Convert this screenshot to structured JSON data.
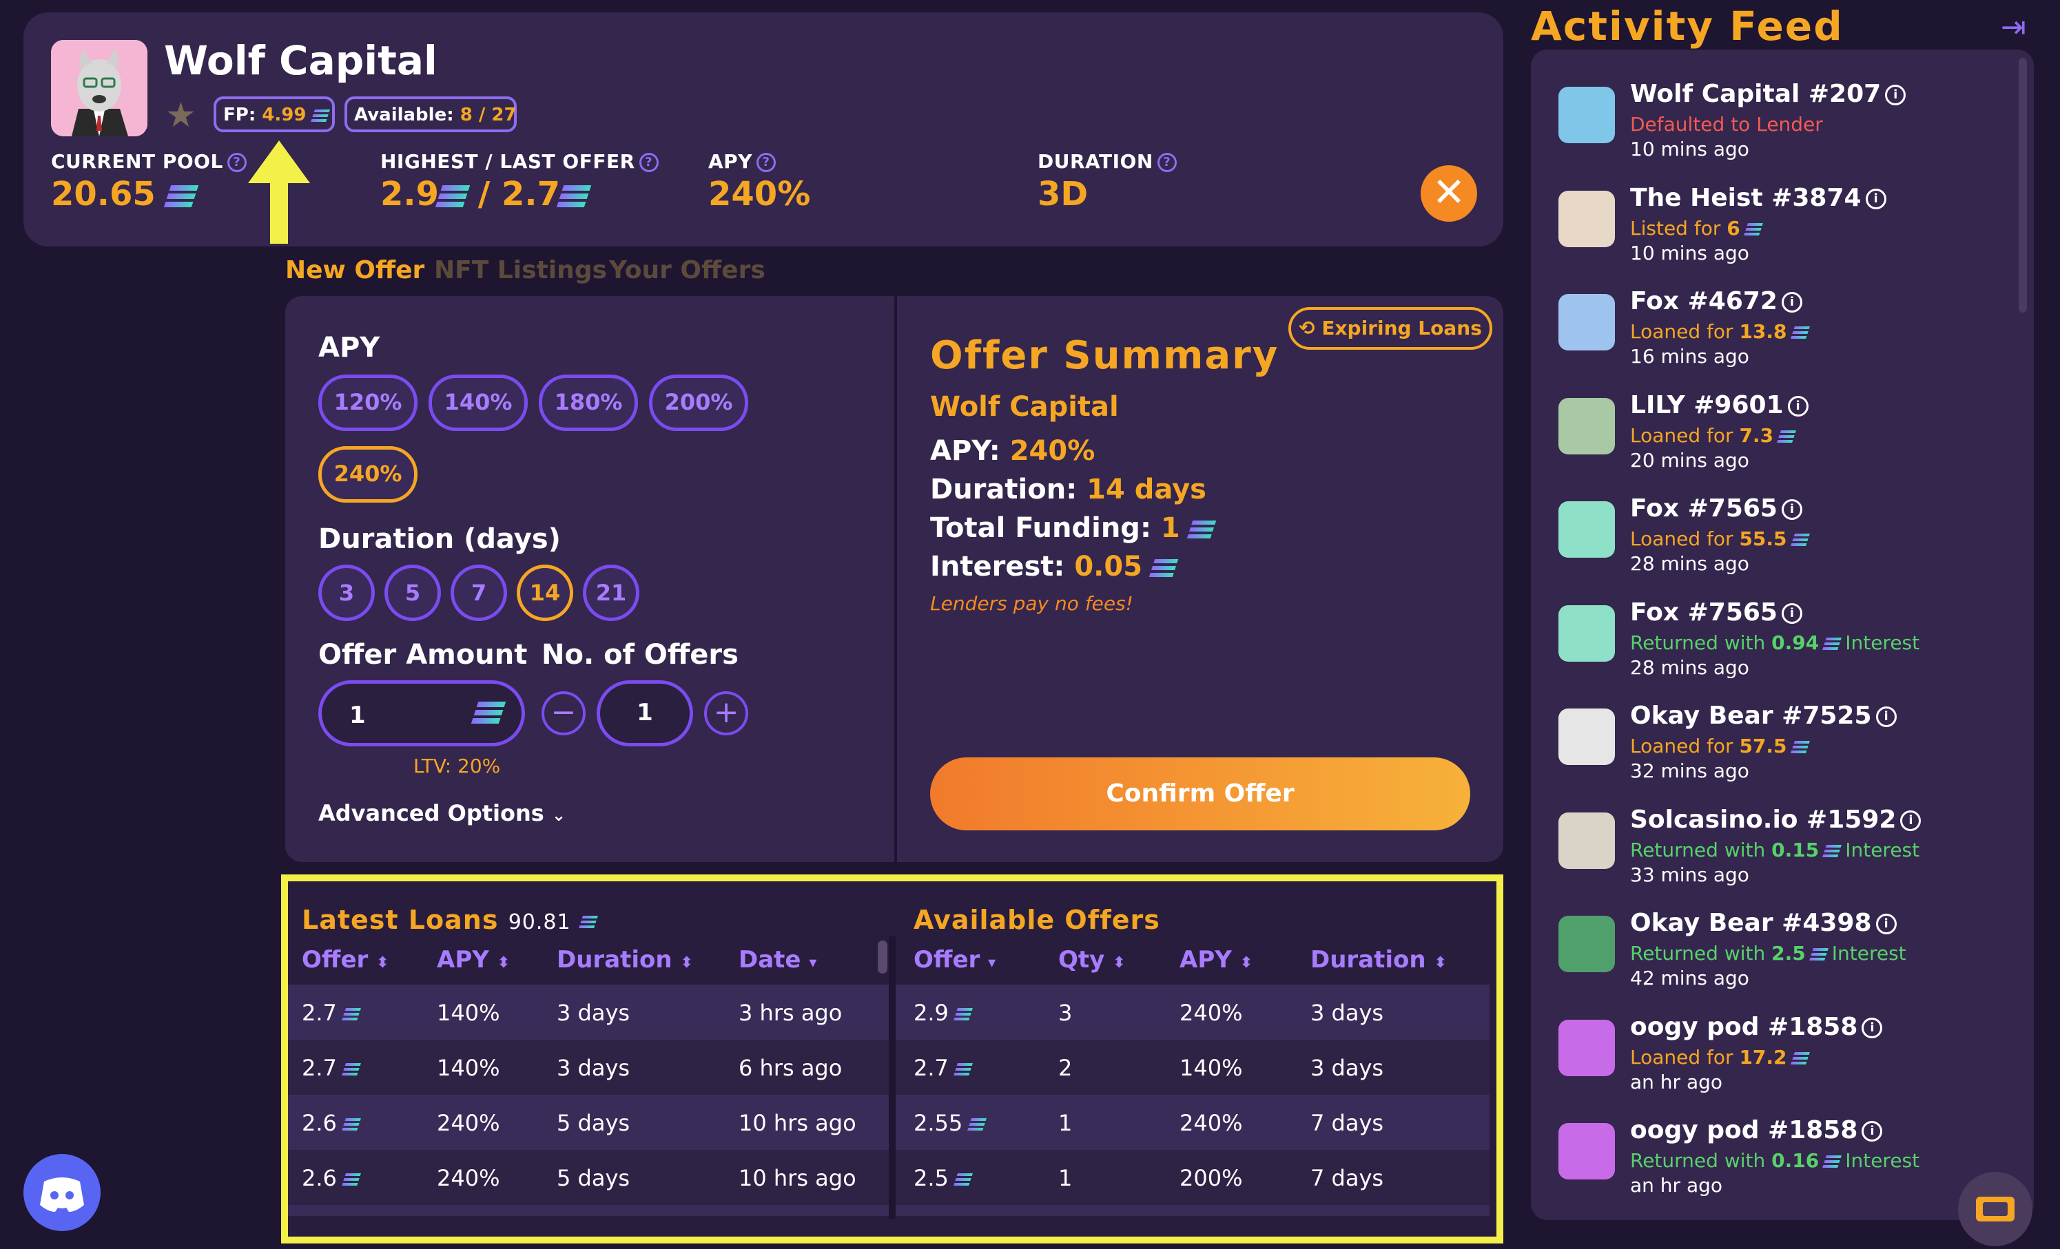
{
  "header": {
    "collection_name": "Wolf Capital",
    "fp_label": "FP:",
    "fp_value": "4.99",
    "available_label": "Available:",
    "available_value": "8 / 27",
    "stats": {
      "current_pool_label": "CURRENT POOL",
      "current_pool_value": "20.65",
      "highest_last_label": "HIGHEST / LAST OFFER",
      "highest_value": "2.9",
      "last_value": "/ 2.7",
      "apy_label": "APY",
      "apy_value": "240%",
      "duration_label": "DURATION",
      "duration_value": "3D"
    },
    "close_glyph": "✕"
  },
  "tabs": [
    "New Offer",
    "NFT Listings",
    "Your Offers"
  ],
  "offer_form": {
    "apy_label": "APY",
    "apy_options": [
      "120%",
      "140%",
      "180%",
      "200%",
      "240%"
    ],
    "apy_selected": "240%",
    "duration_label": "Duration (days)",
    "duration_options": [
      "3",
      "5",
      "7",
      "14",
      "21"
    ],
    "duration_selected": "14",
    "offer_amount_label": "Offer Amount",
    "offer_amount_value": "1",
    "num_offers_label": "No. of Offers",
    "num_offers_value": "1",
    "minus_glyph": "−",
    "plus_glyph": "+",
    "ltv_text": "LTV: 20%",
    "advanced_options_label": "Advanced Options"
  },
  "summary": {
    "expiring_loans_label": "Expiring Loans",
    "title": "Offer Summary",
    "collection": "Wolf Capital",
    "apy_label": "APY:",
    "apy_value": "240%",
    "duration_label": "Duration:",
    "duration_value": "14 days",
    "funding_label": "Total Funding:",
    "funding_value": "1",
    "interest_label": "Interest:",
    "interest_value": "0.05",
    "fees_note": "Lenders pay no fees!",
    "confirm_label": "Confirm Offer"
  },
  "latest_loans": {
    "title": "Latest Loans",
    "total": "90.81",
    "columns": [
      "Offer",
      "APY",
      "Duration",
      "Date"
    ],
    "rows": [
      [
        "2.7",
        "140%",
        "3 days",
        "3 hrs ago"
      ],
      [
        "2.7",
        "140%",
        "3 days",
        "6 hrs ago"
      ],
      [
        "2.6",
        "240%",
        "5 days",
        "10 hrs ago"
      ],
      [
        "2.6",
        "240%",
        "5 days",
        "10 hrs ago"
      ]
    ]
  },
  "available_offers": {
    "title": "Available Offers",
    "columns": [
      "Offer",
      "Qty",
      "APY",
      "Duration"
    ],
    "rows": [
      [
        "2.9",
        "3",
        "240%",
        "3 days"
      ],
      [
        "2.7",
        "2",
        "140%",
        "3 days"
      ],
      [
        "2.55",
        "1",
        "240%",
        "7 days"
      ],
      [
        "2.5",
        "1",
        "200%",
        "7 days"
      ]
    ]
  },
  "activity_feed": {
    "title": "Activity Feed",
    "items": [
      {
        "name": "Wolf Capital #207",
        "status": "Defaulted to Lender",
        "amount": "",
        "suffix": "",
        "time": "10 mins ago",
        "kind": "red",
        "avatar_color": "#7fc6e8"
      },
      {
        "name": "The Heist #3874",
        "status": "Listed for ",
        "amount": "6",
        "suffix": "",
        "time": "10 mins ago",
        "kind": "orange",
        "avatar_color": "#e8d8c8"
      },
      {
        "name": "Fox #4672",
        "status": "Loaned for ",
        "amount": "13.8",
        "suffix": "",
        "time": "16 mins ago",
        "kind": "orange",
        "avatar_color": "#9ec3ef"
      },
      {
        "name": "LILY #9601",
        "status": "Loaned for ",
        "amount": "7.3",
        "suffix": "",
        "time": "20 mins ago",
        "kind": "orange",
        "avatar_color": "#a9c9a4"
      },
      {
        "name": "Fox #7565",
        "status": "Loaned for ",
        "amount": "55.5",
        "suffix": "",
        "time": "28 mins ago",
        "kind": "orange",
        "avatar_color": "#8fe0c8"
      },
      {
        "name": "Fox #7565",
        "status": "Returned with ",
        "amount": "0.94",
        "suffix": "Interest",
        "time": "28 mins ago",
        "kind": "green",
        "avatar_color": "#8fe0c8"
      },
      {
        "name": "Okay Bear #7525",
        "status": "Loaned for ",
        "amount": "57.5",
        "suffix": "",
        "time": "32 mins ago",
        "kind": "orange",
        "avatar_color": "#e6e6e6"
      },
      {
        "name": "Solcasino.io #1592",
        "status": "Returned with ",
        "amount": "0.15",
        "suffix": "Interest",
        "time": "33 mins ago",
        "kind": "green",
        "avatar_color": "#d9d3c8"
      },
      {
        "name": "Okay Bear #4398",
        "status": "Returned with ",
        "amount": "2.5",
        "suffix": "Interest",
        "time": "42 mins ago",
        "kind": "green",
        "avatar_color": "#4fa06a"
      },
      {
        "name": "oogy pod #1858",
        "status": "Loaned for ",
        "amount": "17.2",
        "suffix": "",
        "time": "an hr ago",
        "kind": "orange",
        "avatar_color": "#c86be8"
      },
      {
        "name": "oogy pod #1858",
        "status": "Returned with ",
        "amount": "0.16",
        "suffix": "Interest",
        "time": "an hr ago",
        "kind": "green",
        "avatar_color": "#c86be8"
      }
    ]
  },
  "colors": {
    "background": "#1e1530",
    "panel": "#34264d",
    "accent_orange": "#f5a623",
    "accent_purple": "#7a4cf0",
    "highlight_yellow": "#f4f04a",
    "discord": "#5865f2"
  }
}
